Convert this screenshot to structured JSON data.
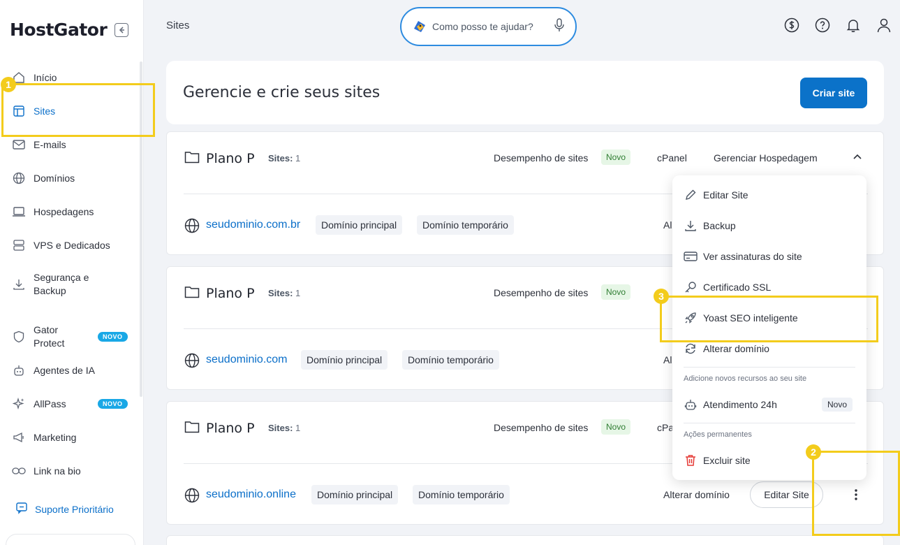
{
  "brand": {
    "logo_text": "HostGator"
  },
  "sidebar": {
    "items": [
      {
        "label": "Início",
        "icon": "home-icon"
      },
      {
        "label": "Sites",
        "icon": "layout-icon",
        "active": true
      },
      {
        "label": "E-mails",
        "icon": "mail-icon"
      },
      {
        "label": "Domínios",
        "icon": "globe-icon"
      },
      {
        "label": "Hospedagens",
        "icon": "laptop-icon"
      },
      {
        "label": "VPS e Dedicados",
        "icon": "server-icon"
      },
      {
        "label": "Segurança e Backup",
        "icon": "download-icon"
      },
      {
        "label": "Gator Protect",
        "icon": "shield-icon",
        "badge": "NOVO"
      },
      {
        "label": "Agentes de IA",
        "icon": "robot-icon"
      },
      {
        "label": "AllPass",
        "icon": "sparkle-icon",
        "badge": "NOVO"
      },
      {
        "label": "Marketing",
        "icon": "megaphone-icon"
      },
      {
        "label": "Link na bio",
        "icon": "link-icon"
      }
    ],
    "support_label": "Suporte Prioritário"
  },
  "topbar": {
    "title": "Sites",
    "search_placeholder": "Como posso te ajudar?"
  },
  "header": {
    "title": "Gerencie e crie seus sites",
    "create_button": "Criar site"
  },
  "plans": [
    {
      "name": "Plano P",
      "sites_label": "Sites:",
      "sites_count": "1",
      "perf_label": "Desempenho de sites",
      "novo": "Novo",
      "cpanel": "cPanel",
      "manage": "Gerenciar Hospedagem",
      "domain": "seudominio.com.br",
      "chip_main": "Domínio principal",
      "chip_temp": "Domínio temporário",
      "alter_partial": "Al"
    },
    {
      "name": "Plano P",
      "sites_label": "Sites:",
      "sites_count": "1",
      "perf_label": "Desempenho de sites",
      "novo": "Novo",
      "domain": "seudominio.com",
      "chip_main": "Domínio principal",
      "chip_temp": "Domínio temporário",
      "alter_partial": "Al"
    },
    {
      "name": "Plano P",
      "sites_label": "Sites:",
      "sites_count": "1",
      "perf_label": "Desempenho de sites",
      "novo": "Novo",
      "cpanel_partial": "cPa",
      "domain": "seudominio.online",
      "chip_main": "Domínio principal",
      "chip_temp": "Domínio temporário",
      "alter_domain": "Alterar domínio",
      "edit_site": "Editar Site"
    }
  ],
  "menu": {
    "items": [
      {
        "label": "Editar Site",
        "icon": "pencil-icon"
      },
      {
        "label": "Backup",
        "icon": "download-icon"
      },
      {
        "label": "Ver assinaturas do site",
        "icon": "credit-card-icon"
      },
      {
        "label": "Certificado SSL",
        "icon": "key-icon"
      },
      {
        "label": "Yoast SEO inteligente",
        "icon": "rocket-icon"
      },
      {
        "label": "Alterar domínio",
        "icon": "refresh-icon"
      }
    ],
    "section_new": "Adicione novos recursos ao seu site",
    "support_24h": "Atendimento 24h",
    "support_24h_badge": "Novo",
    "section_permanent": "Ações permanentes",
    "delete_site": "Excluir site"
  },
  "annotations": {
    "step1": "1",
    "step2": "2",
    "step3": "3",
    "color": "#f3cc1c"
  }
}
